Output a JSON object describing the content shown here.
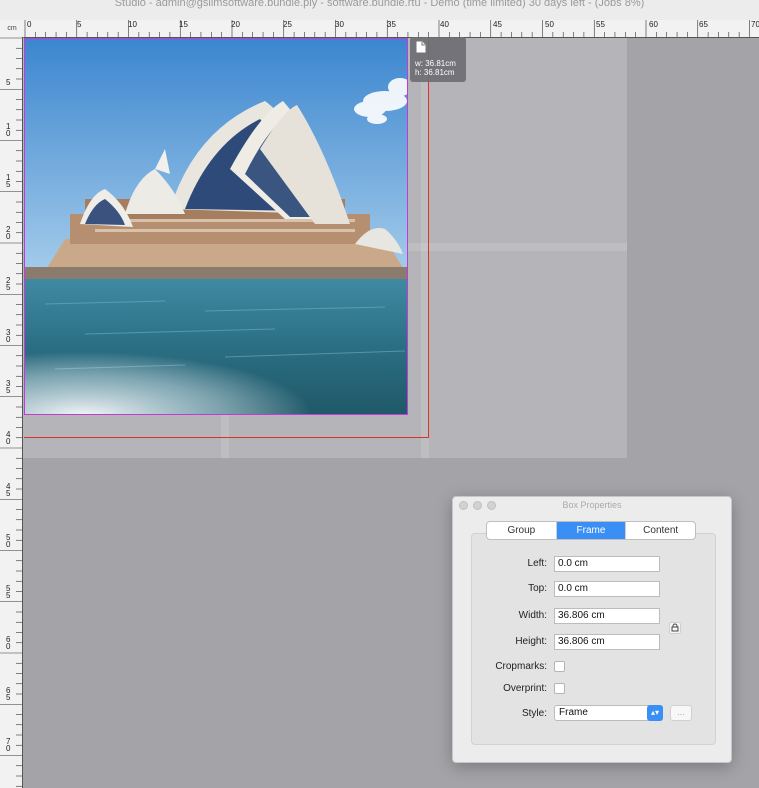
{
  "window": {
    "title": "Studio - admin@gslimsoftware.bundle.ply - software.bundle.rtu - Demo (time limited) 30 days left - (Jobs 8%)"
  },
  "ruler": {
    "unit": "cm",
    "h_labels": [
      "0",
      "5",
      "10",
      "15",
      "20",
      "25",
      "30",
      "35",
      "40",
      "45",
      "50",
      "55",
      "60",
      "65",
      "70"
    ],
    "v_labels": [
      "5",
      "10",
      "15",
      "20",
      "25",
      "30",
      "35",
      "40",
      "45",
      "50",
      "55",
      "60",
      "65",
      "70"
    ]
  },
  "size_tooltip": {
    "icon": "document-icon",
    "width": "w: 36.81cm",
    "height": "h: 36.81cm"
  },
  "box_properties": {
    "title": "Box Properties",
    "tabs": [
      {
        "label": "Group",
        "active": false
      },
      {
        "label": "Frame",
        "active": true
      },
      {
        "label": "Content",
        "active": false
      }
    ],
    "fields": {
      "left": {
        "label": "Left:",
        "value": "0.0 cm"
      },
      "top": {
        "label": "Top:",
        "value": "0.0 cm"
      },
      "width": {
        "label": "Width:",
        "value": "36.806 cm"
      },
      "height": {
        "label": "Height:",
        "value": "36.806 cm"
      }
    },
    "cropmarks": {
      "label": "Cropmarks:",
      "checked": false
    },
    "overprint": {
      "label": "Overprint:",
      "checked": false
    },
    "style": {
      "label": "Style:",
      "value": "Frame"
    },
    "more_button": "...",
    "aspect_lock_icon": "lock-icon"
  },
  "colors": {
    "accent": "#3a8ff6",
    "selection_border": "#c23bd8",
    "bleed_guide": "#e0302a",
    "pasteboard": "#a4a4a8"
  }
}
